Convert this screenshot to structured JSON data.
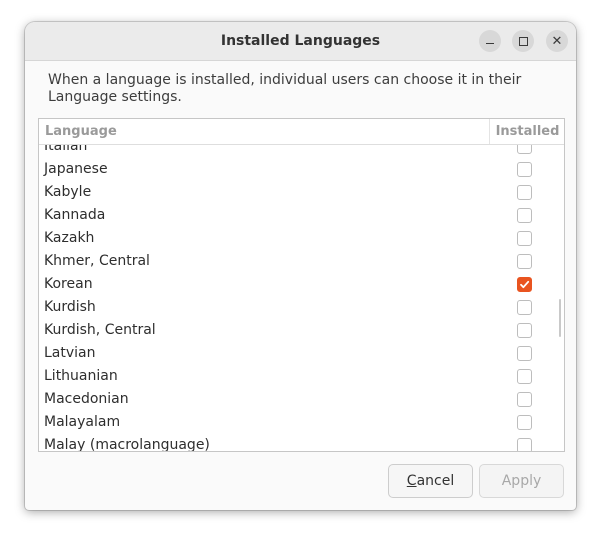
{
  "window": {
    "title": "Installed Languages",
    "controls": [
      "minimize-icon",
      "maximize-icon",
      "close-icon"
    ]
  },
  "description": "When a language is installed, individual users can choose it in their Language settings.",
  "table": {
    "columns": {
      "language": "Language",
      "installed": "Installed"
    },
    "rows": [
      {
        "label": "Italian",
        "installed": false
      },
      {
        "label": "Japanese",
        "installed": false
      },
      {
        "label": "Kabyle",
        "installed": false
      },
      {
        "label": "Kannada",
        "installed": false
      },
      {
        "label": "Kazakh",
        "installed": false
      },
      {
        "label": "Khmer, Central",
        "installed": false
      },
      {
        "label": "Korean",
        "installed": true
      },
      {
        "label": "Kurdish",
        "installed": false
      },
      {
        "label": "Kurdish, Central",
        "installed": false
      },
      {
        "label": "Latvian",
        "installed": false
      },
      {
        "label": "Lithuanian",
        "installed": false
      },
      {
        "label": "Macedonian",
        "installed": false
      },
      {
        "label": "Malayalam",
        "installed": false
      },
      {
        "label": "Malay (macrolanguage)",
        "installed": false
      }
    ]
  },
  "buttons": {
    "cancel_mnemonic": "C",
    "cancel_rest": "ancel",
    "apply": "Apply"
  },
  "colors": {
    "accent": "#e95420"
  }
}
